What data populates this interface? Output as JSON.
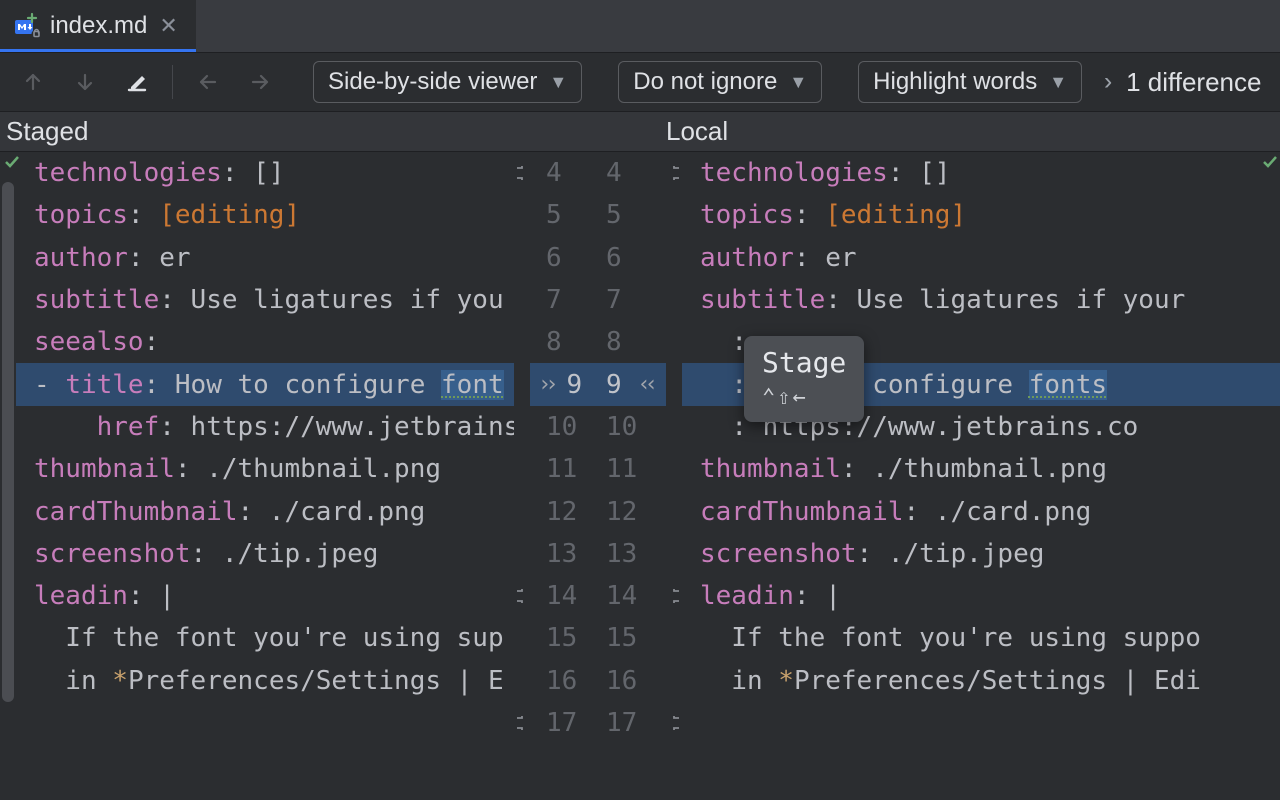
{
  "tab": {
    "filename": "index.md"
  },
  "toolbar": {
    "viewer_mode": "Side-by-side viewer",
    "ignore_mode": "Do not ignore",
    "highlight_mode": "Highlight words",
    "difference_count": "1 difference"
  },
  "headers": {
    "left": "Staged",
    "right": "Local"
  },
  "tooltip": {
    "title": "Stage",
    "shortcut": "⌃⇧←"
  },
  "gutter": {
    "line_numbers": [
      "4",
      "5",
      "6",
      "7",
      "8",
      "9",
      "10",
      "11",
      "12",
      "13",
      "14",
      "15",
      "16",
      "17"
    ]
  },
  "left_code": {
    "l0_key": "technologies",
    "l0_val": ": []",
    "l1_key": "topics",
    "l1_pre": ": ",
    "l1_br_open": "[",
    "l1_item": "editing",
    "l1_br_close": "]",
    "l2_key": "author",
    "l2_val": ": er",
    "l3_key": "subtitle",
    "l3_val": ": Use ligatures if you",
    "l4_key": "seealso",
    "l4_val": ":",
    "l5_pre": "- ",
    "l5_key": "title",
    "l5_mid": ": How to configure ",
    "l5_word": "font",
    "l6_indent": "    ",
    "l6_key": "href",
    "l6_val": ": https://www.jetbrains.",
    "l7_key": "thumbnail",
    "l7_val": ": ./thumbnail.png",
    "l8_key": "cardThumbnail",
    "l8_val": ": ./card.png",
    "l9_key": "screenshot",
    "l9_val": ": ./tip.jpeg",
    "l10_key": "leadin",
    "l10_val": ": |",
    "l11": "  If the font you're using sup",
    "l12_pre": "  in ",
    "l12_star": "*",
    "l12_rest": "Preferences/Settings | E"
  },
  "right_code": {
    "r0_key": "technologies",
    "r0_val": ": []",
    "r1_key": "topics",
    "r1_pre": ": ",
    "r1_br_open": "[",
    "r1_item": "editing",
    "r1_br_close": "]",
    "r2_key": "author",
    "r2_val": ": er",
    "r3_key": "subtitle",
    "r3_val": ": Use ligatures if your",
    "r4_key_tail": ":",
    "r5_mid": ": How to configure ",
    "r5_word": "fonts",
    "r6_val": ": https://www.jetbrains.co",
    "r7_key": "thumbnail",
    "r7_val": ": ./thumbnail.png",
    "r8_key": "cardThumbnail",
    "r8_val": ": ./card.png",
    "r9_key": "screenshot",
    "r9_val": ": ./tip.jpeg",
    "r10_key": "leadin",
    "r10_val": ": |",
    "r11": "  If the font you're using suppo",
    "r12_pre": "  in ",
    "r12_star": "*",
    "r12_rest": "Preferences/Settings | Edi"
  }
}
